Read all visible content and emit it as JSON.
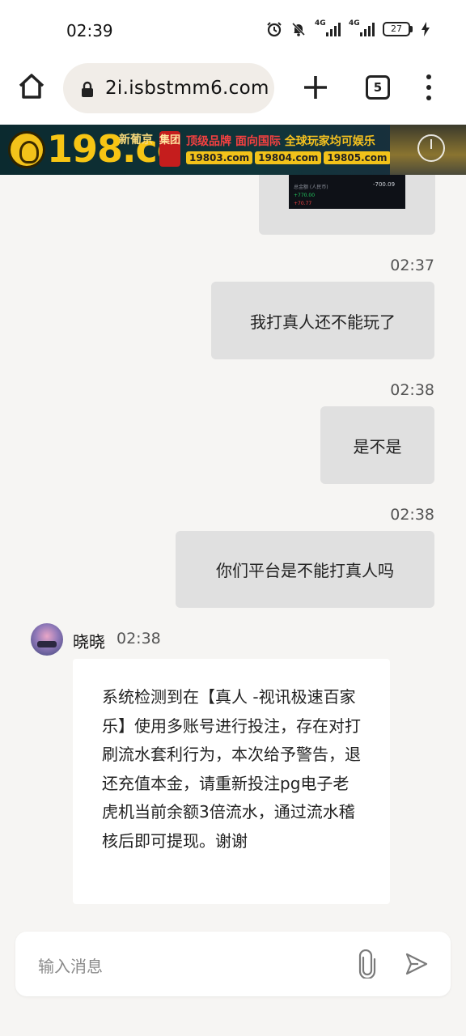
{
  "status_bar": {
    "time": "02:39",
    "net1": "4G",
    "net2": "4G",
    "battery": "27"
  },
  "browser": {
    "url": "2i.isbstmm6.com",
    "tab_count": "5"
  },
  "ad": {
    "brand": "198.cc",
    "brand_cn": "新葡京",
    "seal": "集团",
    "slogan_red": "顶级品牌 面向国际",
    "slogan_yellow": "全球玩家均可娱乐",
    "domains": [
      "19803.com",
      "19804.com",
      "19805.com"
    ]
  },
  "image_preview": {
    "row1_label": "总金额 (人民币)",
    "row1_value": "-700.09",
    "row2": "+770.00",
    "row3": "+70.77"
  },
  "messages": [
    {
      "time": "02:37",
      "text": "我打真人还不能玩了"
    },
    {
      "time": "02:38",
      "text": "是不是"
    },
    {
      "time": "02:38",
      "text": "你们平台是不能打真人吗"
    }
  ],
  "incoming": {
    "sender": "晓晓",
    "time": "02:38",
    "text": "系统检测到在【真人 -视讯极速百家乐】使用多账号进行投注，存在对打刷流水套利行为，本次给予警告，退还充值本金，请重新投注pg电子老虎机当前余额3倍流水，通过流水稽核后即可提现。谢谢"
  },
  "input": {
    "placeholder": "输入消息"
  }
}
